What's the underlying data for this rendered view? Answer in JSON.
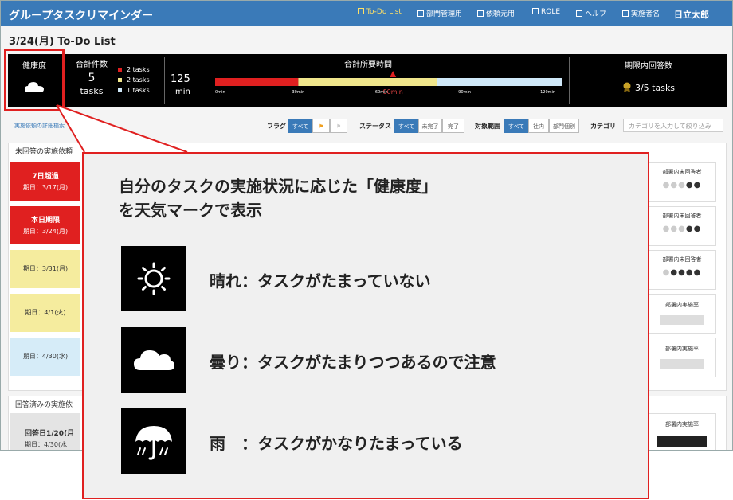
{
  "app": {
    "title": "グループタスクリマインダー"
  },
  "nav": [
    {
      "label": "To-Do List",
      "icon": "list-icon"
    },
    {
      "label": "部門管理用",
      "icon": "department-icon"
    },
    {
      "label": "依頼元用",
      "icon": "request-icon"
    },
    {
      "label": "ROLE",
      "icon": "role-icon"
    },
    {
      "label": "ヘルプ",
      "icon": "help-icon"
    },
    {
      "label": "実施者名",
      "icon": "user-icon"
    }
  ],
  "user": {
    "name": "日立太郎"
  },
  "page": {
    "title": "3/24(月) To-Do List"
  },
  "summary": {
    "health_label": "健康度",
    "health_icon": "cloud-icon",
    "count_label": "合計件数",
    "count_value": "5",
    "count_unit": "tasks",
    "legend": [
      {
        "label": "2 tasks",
        "color": "#e02020"
      },
      {
        "label": "2 tasks",
        "color": "#f0e68c"
      },
      {
        "label": "1 tasks",
        "color": "#cfe8f8"
      }
    ],
    "time_label": "合計所要時間",
    "time_value": "125",
    "time_unit": "min",
    "time_bar": {
      "total_max_min": 125,
      "segments": [
        {
          "minutes": 30,
          "color": "#e02020"
        },
        {
          "minutes": 50,
          "color": "#f0e68c"
        },
        {
          "minutes": 70,
          "color": "#cfe8f8"
        }
      ],
      "ticks": [
        "0min",
        "30min",
        "60min",
        "90min",
        "120min"
      ],
      "marker_label": "90min",
      "marker_value_min": 90
    },
    "answer_label": "期限内回答数",
    "answer_value": "3/5 tasks"
  },
  "filters": {
    "detail_search": "実施依頼の詳細検索",
    "flag_label": "フラグ",
    "flag_all": "すべて",
    "status_label": "ステータス",
    "status_options": [
      "すべて",
      "未完了",
      "完了"
    ],
    "scope_label": "対象範囲",
    "scope_options": [
      "すべて",
      "社内",
      "部門個別"
    ],
    "category_label": "カテゴリ",
    "category_placeholder": "カテゴリを入力して絞り込み"
  },
  "unanswered": {
    "header": "未回答の実施依頼",
    "tasks": [
      {
        "title": "7日超過",
        "date": "期日：3/17(月)"
      },
      {
        "title": "本日期限",
        "date": "期日：3/24(月)"
      },
      {
        "title": "",
        "date": "期日：3/31(月)"
      },
      {
        "title": "",
        "date": "期日：4/1(火)"
      },
      {
        "title": "",
        "date": "期日：4/30(水)"
      }
    ],
    "side": [
      {
        "label": "部署内未回答者"
      },
      {
        "label": "部署内未回答者"
      },
      {
        "label": "部署内未回答者"
      },
      {
        "label": "部署内実施率"
      },
      {
        "label": "部署内実施率"
      }
    ]
  },
  "answered": {
    "header": "回答済みの実施依",
    "task": {
      "title": "回答日1/20(月",
      "date": "期日：4/30(水"
    },
    "side_label": "部署内実施率"
  },
  "callout": {
    "title_line1": "自分のタスクの実施状況に応じた「健康度」",
    "title_line2": "を天気マークで表示",
    "items": [
      {
        "icon": "sun-icon",
        "text": "晴れ：タスクがたまっていない"
      },
      {
        "icon": "cloud-icon",
        "text": "曇り：タスクがたまりつつあるので注意"
      },
      {
        "icon": "umbrella-icon",
        "text": "雨　：タスクがかなりたまっている"
      }
    ]
  }
}
